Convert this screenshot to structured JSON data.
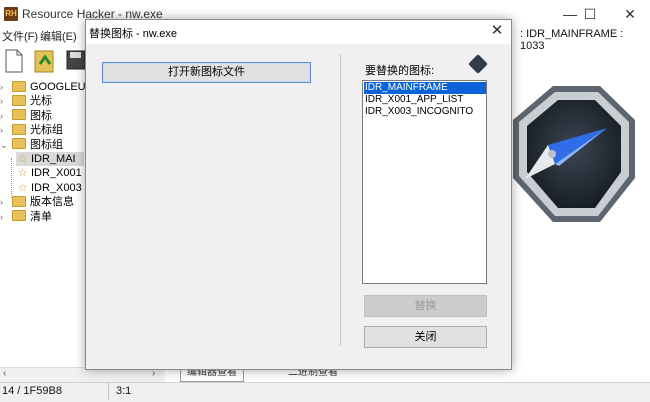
{
  "window": {
    "title": "Resource Hacker - nw.exe",
    "min_glyph": "—",
    "max_glyph": "☐",
    "close_glyph": "✕",
    "right_title": ": IDR_MAINFRAME : 1033"
  },
  "menu": {
    "items": [
      "文件(F)",
      "编辑(E)"
    ]
  },
  "tree": {
    "items": [
      {
        "label": "GOOGLEUPD",
        "type": "folder"
      },
      {
        "label": "光标",
        "type": "folder"
      },
      {
        "label": "图标",
        "type": "folder"
      },
      {
        "label": "光标组",
        "type": "folder"
      },
      {
        "label": "图标组",
        "type": "folder-open"
      },
      {
        "label": "IDR_MAI",
        "type": "star"
      },
      {
        "label": "IDR_X001",
        "type": "star"
      },
      {
        "label": "IDR_X003",
        "type": "star"
      },
      {
        "label": "版本信息",
        "type": "folder"
      },
      {
        "label": "清单",
        "type": "folder"
      }
    ]
  },
  "bottom_tabs": [
    "编辑器查看",
    "二进制查看"
  ],
  "status": {
    "left": "14 / 1F59B8",
    "middle": "3:1"
  },
  "dialog": {
    "title": "替换图标 - nw.exe",
    "close_glyph": "✕",
    "open_button": "打开新图标文件",
    "list_label": "要替换的图标:",
    "icons": [
      "IDR_MAINFRAME",
      "IDR_X001_APP_LIST",
      "IDR_X003_INCOGNITO"
    ],
    "selected_index": 0,
    "replace_button": "替换",
    "close_button": "关闭"
  },
  "colors": {
    "selection": "#0a64d8",
    "dialog_bg": "#f0f0f0",
    "accent_border": "#5b8fd0"
  }
}
